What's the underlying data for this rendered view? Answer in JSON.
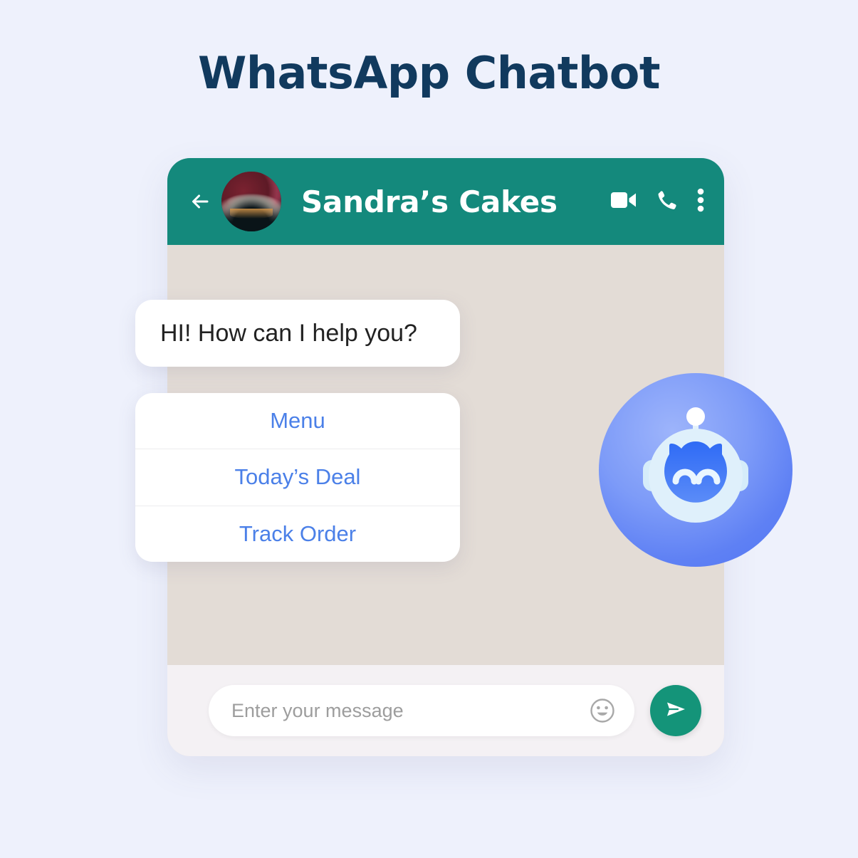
{
  "page": {
    "title": "WhatsApp Chatbot",
    "background_color": "#eef1fc",
    "title_color": "#113a5e"
  },
  "chat": {
    "header": {
      "contact_name": "Sandra’s Cakes",
      "background_color": "#14897c",
      "back_icon": "back-arrow-icon",
      "avatar_icon": "contact-avatar-cake-photo",
      "actions": [
        {
          "icon": "video-call-icon",
          "label": "Video call"
        },
        {
          "icon": "voice-call-icon",
          "label": "Voice call"
        },
        {
          "icon": "more-options-icon",
          "label": "More options"
        }
      ]
    },
    "body": {
      "background_color": "#e3dcd6",
      "messages": [
        {
          "id": "greeting",
          "type": "text",
          "sender": "bot",
          "text": "HI! How can I help you?"
        },
        {
          "id": "quick-replies",
          "type": "options",
          "sender": "bot",
          "option_color": "#4b80e8",
          "options": [
            {
              "label": "Menu"
            },
            {
              "label": "Today’s Deal"
            },
            {
              "label": "Track Order"
            }
          ]
        }
      ]
    },
    "composer": {
      "background_color": "#f4f1f4",
      "input_value": "",
      "input_placeholder": "Enter your message",
      "emoji_icon": "emoji-smiley-icon",
      "send_icon": "send-paper-plane-icon",
      "send_button_color": "#149479"
    }
  },
  "bot_badge": {
    "icon": "robot-bot-avatar-icon",
    "circle_color": "#5e80f4",
    "face_color": "#dff0fb"
  }
}
